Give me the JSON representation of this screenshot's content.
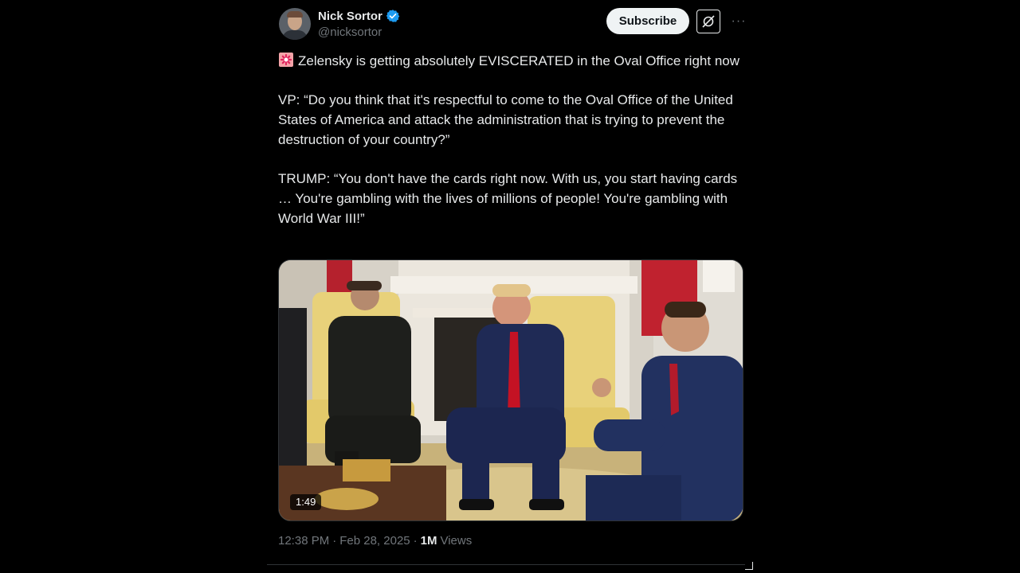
{
  "author": {
    "display_name": "Nick Sortor",
    "handle": "@nicksortor",
    "avatar_icon": "avatar-photo",
    "verified_icon": "verified-badge-icon",
    "verified_color": "#1d9bf0"
  },
  "actions": {
    "subscribe_label": "Subscribe",
    "grok_icon": "grok-icon",
    "more_icon": "more-horizontal-icon",
    "more_text": "···"
  },
  "tweet": {
    "emoji_icon": "police-siren-icon",
    "text": "Zelensky is getting absolutely EVISCERATED in the Oval Office right now\n\nVP: “Do you think that it's respectful to come to the Oval Office of the United States of America and attack the administration that is trying to prevent the destruction of your country?”\n\nTRUMP: “You don't have the cards right now. With us, you start having cards … You're gambling with the lives of millions of people! You're gambling with World War III!”"
  },
  "media": {
    "type": "video",
    "duration": "1:49"
  },
  "meta": {
    "time": "12:38 PM",
    "separator": "·",
    "date": "Feb 28, 2025",
    "views_count": "1M",
    "views_label": "Views"
  },
  "colors": {
    "background": "#000000",
    "text": "#e7e9ea",
    "secondary_text": "#71767b",
    "accent": "#1d9bf0"
  }
}
